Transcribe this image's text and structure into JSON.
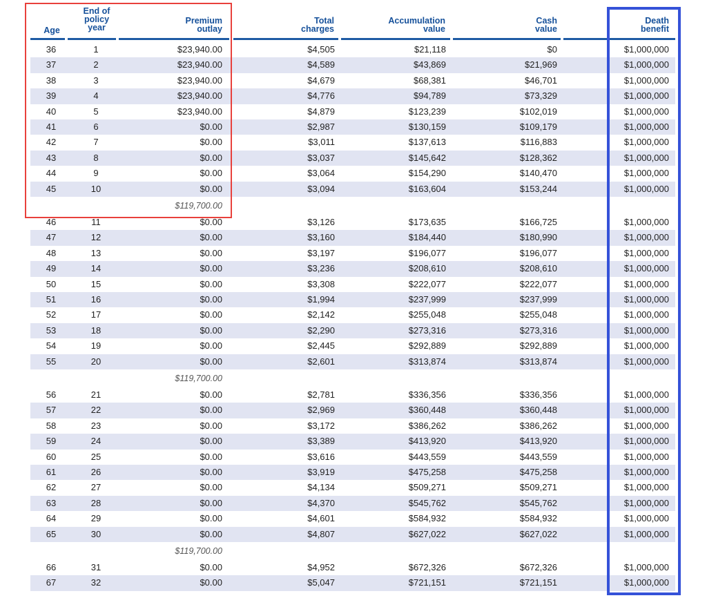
{
  "headers": {
    "age": [
      "Age"
    ],
    "policy_year": [
      "End of",
      "policy",
      "year"
    ],
    "premium": [
      "Premium",
      "outlay"
    ],
    "charges": [
      "Total",
      "charges"
    ],
    "accumulation": [
      "Accumulation",
      "value"
    ],
    "cash": [
      "Cash",
      "value"
    ],
    "death": [
      "Death",
      "benefit"
    ]
  },
  "groups": [
    {
      "rows": [
        [
          "36",
          "1",
          "$23,940.00",
          "$4,505",
          "$21,118",
          "$0",
          "$1,000,000"
        ],
        [
          "37",
          "2",
          "$23,940.00",
          "$4,589",
          "$43,869",
          "$21,969",
          "$1,000,000"
        ],
        [
          "38",
          "3",
          "$23,940.00",
          "$4,679",
          "$68,381",
          "$46,701",
          "$1,000,000"
        ],
        [
          "39",
          "4",
          "$23,940.00",
          "$4,776",
          "$94,789",
          "$73,329",
          "$1,000,000"
        ],
        [
          "40",
          "5",
          "$23,940.00",
          "$4,879",
          "$123,239",
          "$102,019",
          "$1,000,000"
        ],
        [
          "41",
          "6",
          "$0.00",
          "$2,987",
          "$130,159",
          "$109,179",
          "$1,000,000"
        ],
        [
          "42",
          "7",
          "$0.00",
          "$3,011",
          "$137,613",
          "$116,883",
          "$1,000,000"
        ],
        [
          "43",
          "8",
          "$0.00",
          "$3,037",
          "$145,642",
          "$128,362",
          "$1,000,000"
        ],
        [
          "44",
          "9",
          "$0.00",
          "$3,064",
          "$154,290",
          "$140,470",
          "$1,000,000"
        ],
        [
          "45",
          "10",
          "$0.00",
          "$3,094",
          "$163,604",
          "$153,244",
          "$1,000,000"
        ]
      ],
      "subtotal": "$119,700.00"
    },
    {
      "rows": [
        [
          "46",
          "11",
          "$0.00",
          "$3,126",
          "$173,635",
          "$166,725",
          "$1,000,000"
        ],
        [
          "47",
          "12",
          "$0.00",
          "$3,160",
          "$184,440",
          "$180,990",
          "$1,000,000"
        ],
        [
          "48",
          "13",
          "$0.00",
          "$3,197",
          "$196,077",
          "$196,077",
          "$1,000,000"
        ],
        [
          "49",
          "14",
          "$0.00",
          "$3,236",
          "$208,610",
          "$208,610",
          "$1,000,000"
        ],
        [
          "50",
          "15",
          "$0.00",
          "$3,308",
          "$222,077",
          "$222,077",
          "$1,000,000"
        ],
        [
          "51",
          "16",
          "$0.00",
          "$1,994",
          "$237,999",
          "$237,999",
          "$1,000,000"
        ],
        [
          "52",
          "17",
          "$0.00",
          "$2,142",
          "$255,048",
          "$255,048",
          "$1,000,000"
        ],
        [
          "53",
          "18",
          "$0.00",
          "$2,290",
          "$273,316",
          "$273,316",
          "$1,000,000"
        ],
        [
          "54",
          "19",
          "$0.00",
          "$2,445",
          "$292,889",
          "$292,889",
          "$1,000,000"
        ],
        [
          "55",
          "20",
          "$0.00",
          "$2,601",
          "$313,874",
          "$313,874",
          "$1,000,000"
        ]
      ],
      "subtotal": "$119,700.00"
    },
    {
      "rows": [
        [
          "56",
          "21",
          "$0.00",
          "$2,781",
          "$336,356",
          "$336,356",
          "$1,000,000"
        ],
        [
          "57",
          "22",
          "$0.00",
          "$2,969",
          "$360,448",
          "$360,448",
          "$1,000,000"
        ],
        [
          "58",
          "23",
          "$0.00",
          "$3,172",
          "$386,262",
          "$386,262",
          "$1,000,000"
        ],
        [
          "59",
          "24",
          "$0.00",
          "$3,389",
          "$413,920",
          "$413,920",
          "$1,000,000"
        ],
        [
          "60",
          "25",
          "$0.00",
          "$3,616",
          "$443,559",
          "$443,559",
          "$1,000,000"
        ],
        [
          "61",
          "26",
          "$0.00",
          "$3,919",
          "$475,258",
          "$475,258",
          "$1,000,000"
        ],
        [
          "62",
          "27",
          "$0.00",
          "$4,134",
          "$509,271",
          "$509,271",
          "$1,000,000"
        ],
        [
          "63",
          "28",
          "$0.00",
          "$4,370",
          "$545,762",
          "$545,762",
          "$1,000,000"
        ],
        [
          "64",
          "29",
          "$0.00",
          "$4,601",
          "$584,932",
          "$584,932",
          "$1,000,000"
        ],
        [
          "65",
          "30",
          "$0.00",
          "$4,807",
          "$627,022",
          "$627,022",
          "$1,000,000"
        ]
      ],
      "subtotal": "$119,700.00"
    },
    {
      "rows": [
        [
          "66",
          "31",
          "$0.00",
          "$4,952",
          "$672,326",
          "$672,326",
          "$1,000,000"
        ],
        [
          "67",
          "32",
          "$0.00",
          "$5,047",
          "$721,151",
          "$721,151",
          "$1,000,000"
        ]
      ]
    }
  ],
  "colors": {
    "header_text": "#15509a",
    "rule": "#1e5aa4",
    "row_stripe": "#e1e4f2",
    "highlight_red": "#e8403b",
    "highlight_blue": "#3552d8"
  }
}
